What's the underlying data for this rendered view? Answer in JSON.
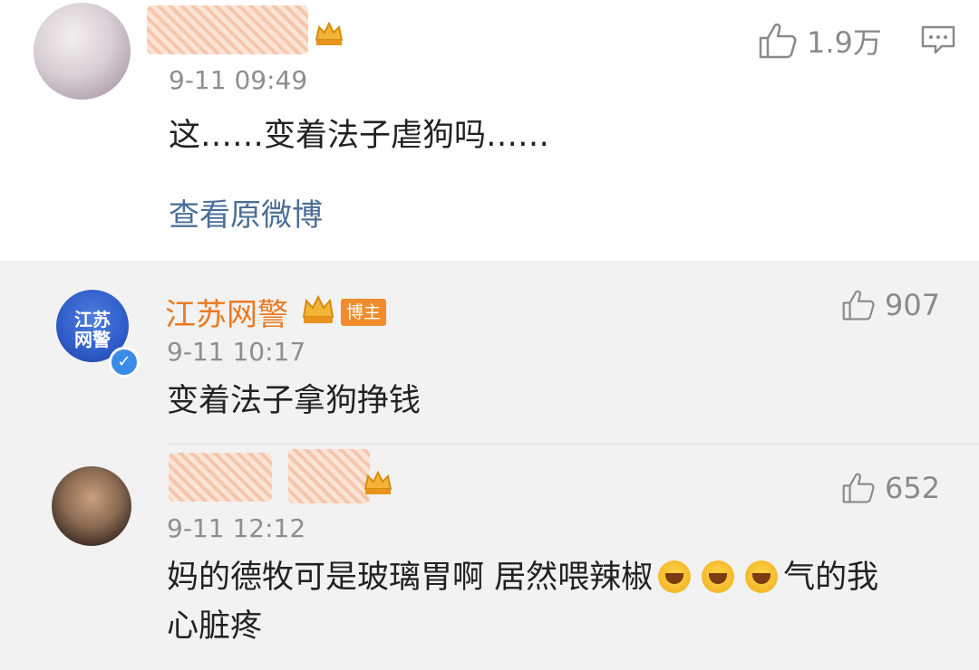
{
  "comments": [
    {
      "time": "9-11 09:49",
      "text": "这……变着法子虐狗吗……",
      "likes": "1.9万",
      "link": "查看原微博"
    }
  ],
  "replies": [
    {
      "username": "江苏网警",
      "badge": "博主",
      "avatar_text_1": "江苏",
      "avatar_text_2": "网警",
      "time": "9-11 10:17",
      "text": "变着法子拿狗挣钱",
      "likes": "907"
    },
    {
      "time": "9-11 12:12",
      "text_part_1": "妈的德牧可是玻璃胃啊 居然喂辣椒",
      "text_part_2": "气的我",
      "text_line_2": "心脏疼",
      "likes": "652"
    }
  ],
  "icons": {
    "like": "thumbs-up-icon",
    "comment": "comment-bubble-icon",
    "crown": "crown-icon",
    "verified": "verified-icon",
    "emoji": "crying-face-icon"
  },
  "colors": {
    "username": "#eb7a22",
    "badge": "#f08c2c",
    "link": "#4b6e96",
    "verified": "#3a8be8"
  }
}
